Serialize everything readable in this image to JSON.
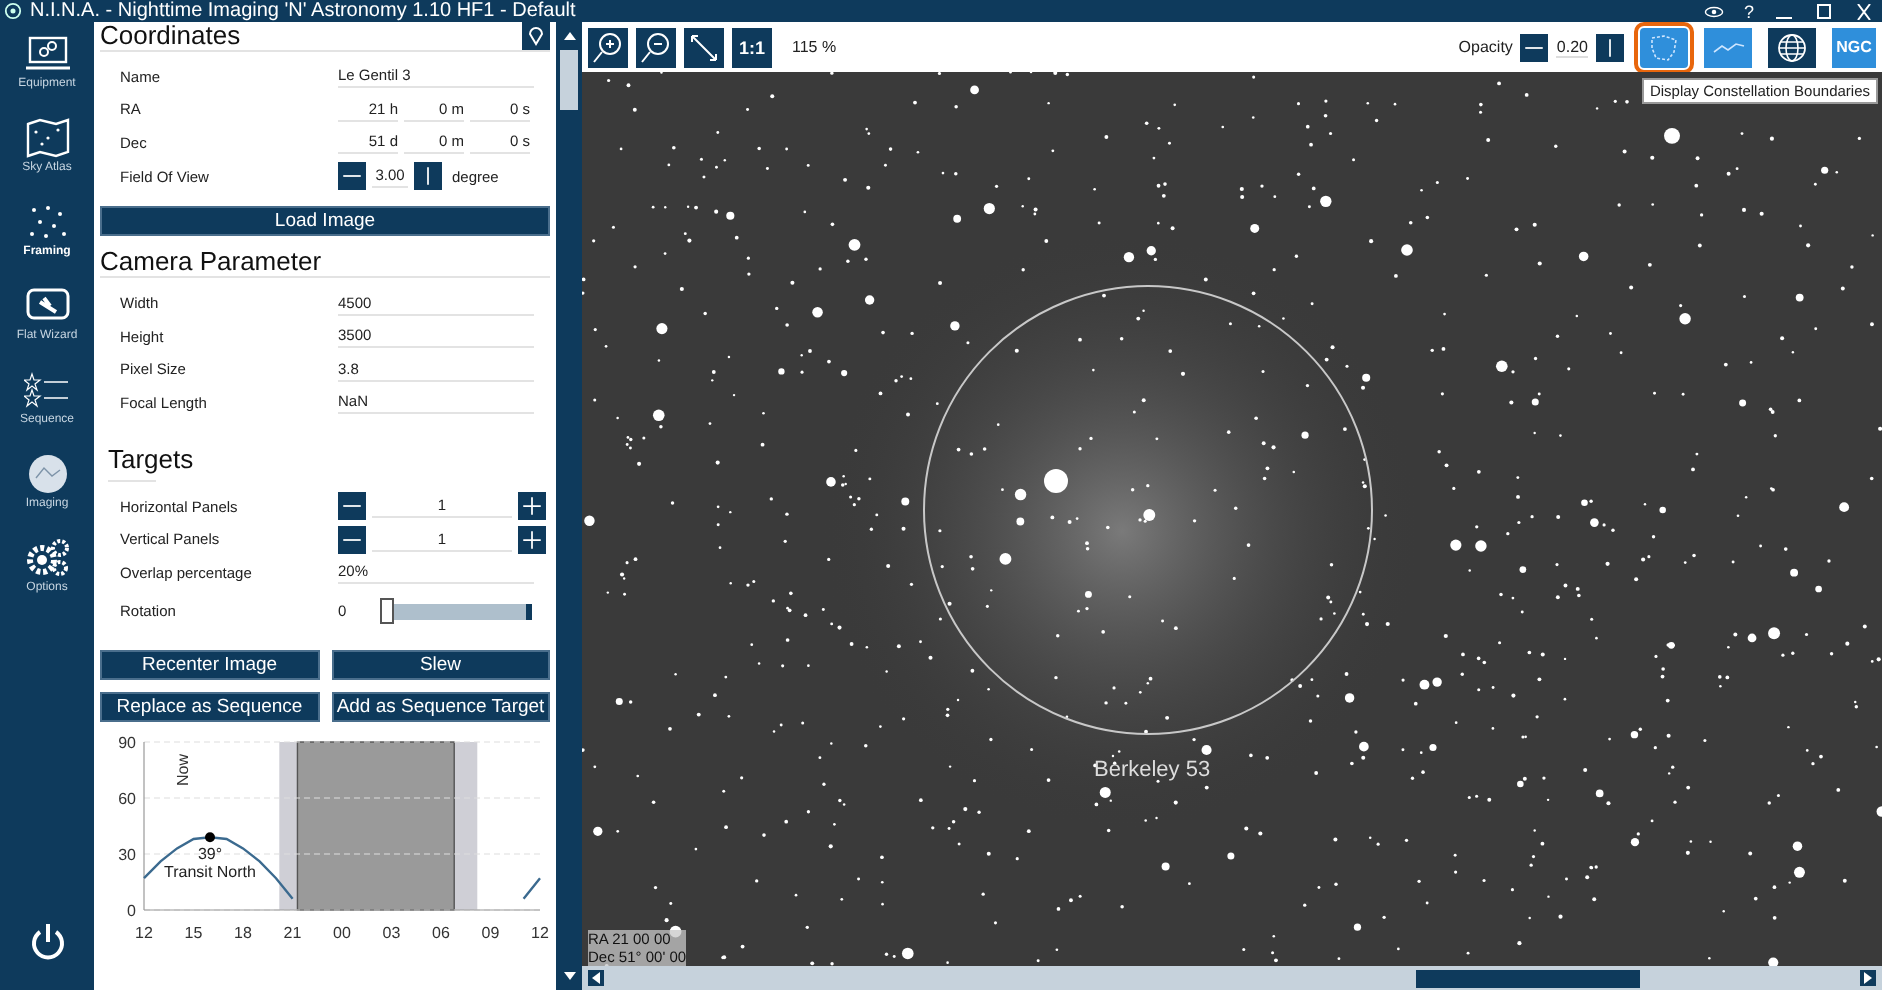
{
  "window": {
    "title": "N.I.N.A. - Nighttime Imaging 'N' Astronomy 1.10 HF1  -  Default",
    "help": "?"
  },
  "sidebar": {
    "items": [
      {
        "label": "Equipment",
        "selected": false
      },
      {
        "label": "Sky Atlas",
        "selected": false
      },
      {
        "label": "Framing",
        "selected": true
      },
      {
        "label": "Flat Wizard",
        "selected": false
      },
      {
        "label": "Sequence",
        "selected": false
      },
      {
        "label": "Imaging",
        "selected": false
      },
      {
        "label": "Options",
        "selected": false
      }
    ]
  },
  "coordinates": {
    "title": "Coordinates",
    "fields": [
      {
        "label": "Name",
        "values": [
          "Le Gentil 3"
        ]
      },
      {
        "label": "RA",
        "values": [
          "21 h",
          "0 m",
          "0 s"
        ]
      },
      {
        "label": "Dec",
        "values": [
          "51 d",
          "0 m",
          "0 s"
        ]
      }
    ],
    "fov": {
      "label": "Field Of View",
      "value": "3.00",
      "unit": "degree"
    }
  },
  "load_button": "Load Image",
  "camera": {
    "title": "Camera Parameter",
    "fields": [
      {
        "label": "Width",
        "value": "4500"
      },
      {
        "label": "Height",
        "value": "3500"
      },
      {
        "label": "Pixel Size",
        "value": "3.8"
      },
      {
        "label": "Focal Length",
        "value": "NaN"
      }
    ]
  },
  "targets": {
    "title": "Targets",
    "panels": [
      {
        "label": "Horizontal Panels",
        "value": "1"
      },
      {
        "label": "Vertical Panels",
        "value": "1"
      }
    ],
    "overlap": {
      "label": "Overlap percentage",
      "value": "20%"
    },
    "rotation": {
      "label": "Rotation",
      "value": "0",
      "level": 0
    }
  },
  "buttons": [
    "Recenter Image",
    "Slew",
    "Replace as Sequence",
    "Add as Sequence Target"
  ],
  "altitude_chart": {
    "chart_data": {
      "type": "line",
      "x": [
        12,
        13,
        14,
        15,
        16,
        17,
        18,
        19,
        20,
        21,
        22,
        23,
        24,
        25,
        26,
        27,
        28,
        29,
        30,
        31,
        32,
        33,
        34,
        35,
        36
      ],
      "series": [
        {
          "color": "#3b6a8f",
          "values": [
            17,
            26,
            33,
            38,
            39,
            38,
            33,
            26,
            17,
            6,
            null,
            null,
            null,
            null,
            null,
            null,
            null,
            null,
            null,
            null,
            null,
            null,
            null,
            6,
            17
          ]
        }
      ],
      "xlim": [
        12,
        36
      ],
      "ylim": [
        0,
        90
      ],
      "xticks": [
        {
          "value": 12,
          "label": "12"
        },
        {
          "value": 15,
          "label": "15"
        },
        {
          "value": 18,
          "label": "18"
        },
        {
          "value": 21,
          "label": "21"
        },
        {
          "value": 24,
          "label": "00"
        },
        {
          "value": 27,
          "label": "03"
        },
        {
          "value": 30,
          "label": "06"
        },
        {
          "value": 33,
          "label": "09"
        },
        {
          "value": 36,
          "label": "12"
        }
      ],
      "yticks": [
        0,
        30,
        60,
        90
      ],
      "annotations": [
        "Now",
        "39°",
        "Transit North"
      ]
    }
  },
  "toolbar": {
    "actual_size": "1:1",
    "zoom_level": "115 %",
    "opacity": {
      "label": "Opacity",
      "value": "0.20"
    },
    "toggles": [
      {
        "kind": "boundaries",
        "on": true,
        "focused": true
      },
      {
        "kind": "lines",
        "on": true,
        "focused": false
      },
      {
        "kind": "grid",
        "on": false,
        "focused": false
      },
      {
        "kind": "ngc",
        "label": "NGC",
        "on": true,
        "focused": false
      }
    ],
    "tooltip": "Display Constellation Boundaries"
  },
  "image": {
    "target_label": "Berkeley 53",
    "ra": "RA 21 00 00",
    "dec": "Dec 51° 00' 00"
  }
}
